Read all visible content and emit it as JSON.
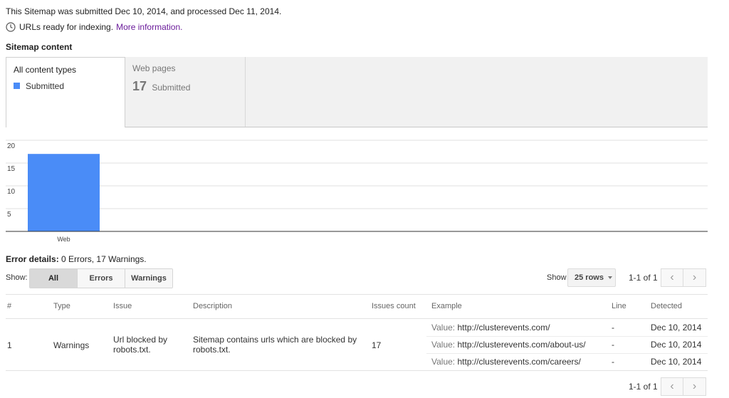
{
  "header": {
    "cutoff_bold": "",
    "cutoff_accent": "",
    "submitted_text": "This Sitemap was submitted Dec 10, 2014, and processed Dec 11, 2014.",
    "status_text": "URLs ready for indexing.",
    "more_info_link": "More information."
  },
  "sitemap_content": {
    "title": "Sitemap content",
    "tabs": [
      {
        "label": "All content types",
        "legend": "Submitted",
        "active": true
      },
      {
        "label": "Web pages",
        "count": "17",
        "count_label": "Submitted",
        "active": false
      }
    ],
    "series_color": "#4a8cf7"
  },
  "chart_data": {
    "type": "bar",
    "categories": [
      "Web"
    ],
    "series": [
      {
        "name": "Submitted",
        "values": [
          17
        ]
      }
    ],
    "ylim": [
      0,
      20
    ],
    "yticks": [
      5,
      10,
      15,
      20
    ],
    "grid": true,
    "color": "#4a8cf7"
  },
  "errors": {
    "title": "Error details:",
    "summary": "0 Errors, 17 Warnings.",
    "show_label": "Show:",
    "filters": [
      "All",
      "Errors",
      "Warnings"
    ],
    "active_filter": "All"
  },
  "pagination": {
    "show_label": "Show",
    "rows_value": "25 rows",
    "range_top": "1-1 of 1",
    "range_bottom": "1-1 of 1"
  },
  "table": {
    "columns": [
      "#",
      "Type",
      "Issue",
      "Description",
      "Issues count",
      "Example",
      "Line",
      "Detected"
    ],
    "rows": [
      {
        "num": "1",
        "type": "Warnings",
        "issue_l1": "Url blocked by",
        "issue_l2": "robots.txt.",
        "desc_l1": "Sitemap contains urls which are blocked by",
        "desc_l2": "robots.txt.",
        "count": "17",
        "examples": [
          {
            "value_label": "Value:",
            "url": "http://clusterevents.com/",
            "line": "-",
            "detected": "Dec 10, 2014"
          },
          {
            "value_label": "Value:",
            "url": "http://clusterevents.com/about-us/",
            "line": "-",
            "detected": "Dec 10, 2014"
          },
          {
            "value_label": "Value:",
            "url": "http://clusterevents.com/careers/",
            "line": "-",
            "detected": "Dec 10, 2014"
          }
        ]
      }
    ]
  }
}
